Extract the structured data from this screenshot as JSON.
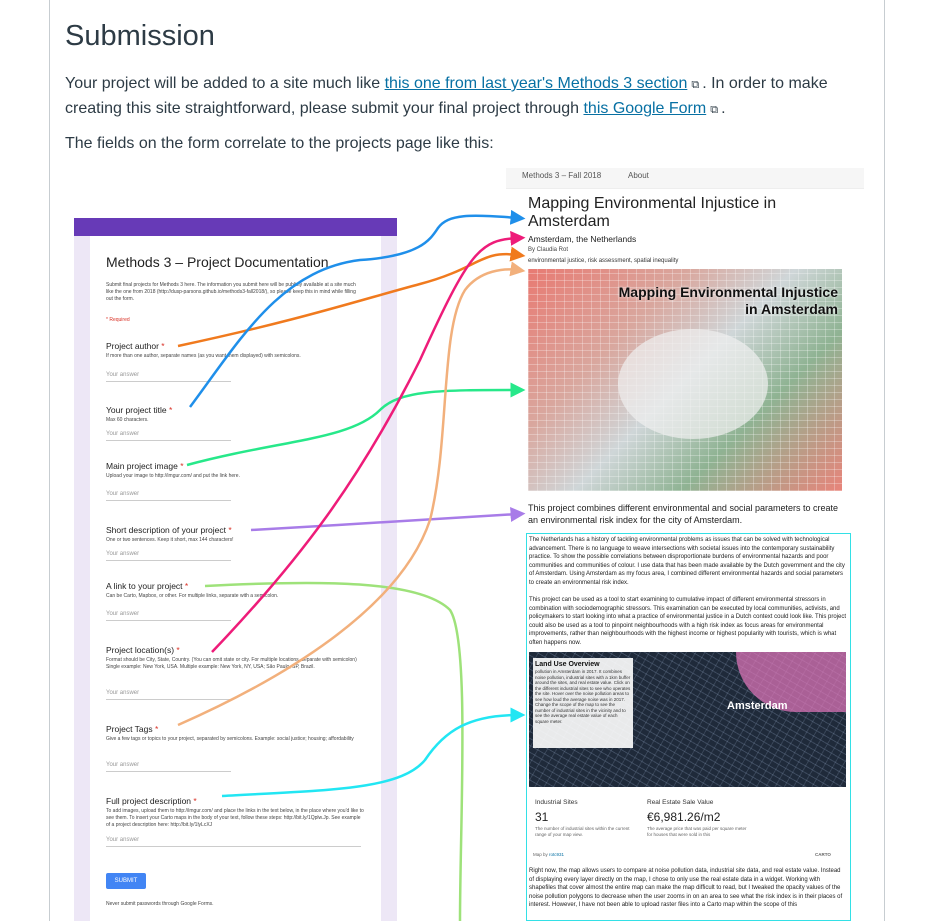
{
  "page": {
    "heading": "Submission",
    "intro_start": "Your project will be added to a site much like ",
    "link1": "this one from last year's Methods 3 section",
    "intro_mid": ". In order to make creating this site straightforward, please submit your final project through ",
    "link2": "this Google Form",
    "intro_end": ".",
    "correlate": "The fields on the form correlate to the projects page like this:",
    "external_icon": "external-link-icon"
  },
  "form": {
    "title": "Methods 3 – Project Documentation",
    "intro": "Submit final projects for Methods 3 here. The information you submit here will be publicly available at a site much like the one from 2018 (http://dusp-parsons.github.io/methods3-fall2018/), so please keep this in mind while filling out the form.",
    "required_note": "* Required",
    "answer_placeholder": "Your answer",
    "questions": [
      {
        "label": "Project author",
        "help": "If more than one author, separate names (as you want them displayed) with semicolons."
      },
      {
        "label": "Your project title",
        "help": "Max 60 characters."
      },
      {
        "label": "Main project image",
        "help": "Upload your image to http://imgur.com/ and put the link here."
      },
      {
        "label": "Short description of your project",
        "help": "One or two sentences. Keep it short, max 144 characters!"
      },
      {
        "label": "A link to your project",
        "help": "Can be Carto, Mapbox, or other. For multiple links, separate with a semicolon."
      },
      {
        "label": "Project location(s)",
        "help": "Format should be City, State, Country. (You can omit state or city. For multiple locations, separate with semicolon) Single example: New York, USA. Multiple example: New York, NY, USA; São Paulo, SP, Brazil."
      },
      {
        "label": "Project Tags",
        "help": "Give a few tags or topics to your project, separated by semicolons. Example: social justice; housing; affordability"
      },
      {
        "label": "Full project description",
        "help": "To add images, upload them to http://imgur.com/ and place the links in the text below, in the place where you'd like to see them. To insert your Carto maps in the body of your text, follow these steps: http://bit.ly/1Qplw.Jp. See example of a project description here: http://bit.ly/1lyLcXJ"
      }
    ],
    "submit": "SUBMIT",
    "footer": "Never submit passwords through Google Forms."
  },
  "project_page": {
    "nav_site": "Methods 3 – Fall 2018",
    "nav_about": "About",
    "title": "Mapping Environmental Injustice in Amsterdam",
    "location": "Amsterdam, the Netherlands",
    "author": "By Claudia Rot",
    "tags": "environmental justice, risk assessment, spatial inequality",
    "image_title_line1": "Mapping Environmental Injustice",
    "image_title_line2": "in Amsterdam",
    "short_description": "This project combines different environmental and social parameters to create an environmental risk index for the city of Amsterdam.",
    "body_p1": "The Netherlands has a history of tackling environmental problems as issues that can be solved with technological advancement. There is no language to weave intersections with societal issues into the contemporary sustainability practice. To show the possible correlations between disproportionate burdens of environmental hazards and poor communities and communities of colour. I use data that has been made available by the Dutch government and the city of Amsterdam. Using Amsterdam as my focus area, I combined different environmental hazards and social parameters to create an environmental risk index.",
    "body_p2": "This project can be used as a tool to start examining to cumulative impact of different environmental stressors in combination with sociodemographic stressors. This examination can be executed by local communities, activists, and policymakers to start looking into what a practice of environmental justice in a Dutch context could look like. This project could also be used as a tool to pinpoint neighbourhoods with a high risk index as focus areas for environmental improvements, rather than neighbourhoods with the highest income or highest popularity with tourists, which is what often happens now.",
    "embed_panel_title": "Land Use Overview",
    "embed_panel_text": "pollution in Amsterdam in 2017. It combines noise pollution, industrial sites with a 1km buffer around the sites, and real estate value. Click on the different industrial sites to see who operates the site. Hover over the noise pollution areas to see how loud the average noise was in 2017. Change the scope of the map to see the number of industrial sites in the vicinity and to see the average real estate value of each square meter.",
    "embed_city_label": "Amsterdam",
    "widget1_title": "Industrial Sites",
    "widget1_value": "31",
    "widget1_desc": "The number of industrial sites within the current range of your map view.",
    "widget2_title": "Real Estate Sale Value",
    "widget2_value": "€6,981.26/m2",
    "widget2_desc": "The average price that was paid per square meter for houses that were sold in this",
    "map_by": "Map by",
    "map_author": "rotc931",
    "carto_logo": "CARTO",
    "body_p3": "Right now, the map allows users to compare at noise pollution data, industrial site data, and real estate value. Instead of displaying every layer directly on the map, I chose to only use the real estate data in a widget. Working with shapefiles that cover almost the entire map can make the map difficult to read, but I tweaked the opacity values of the noise pollution polygons to decrease when the user zooms in on an area to see what the risk index is in their places of interest. However, I have not been able to upload raster files into a Carto map within the scope of this"
  },
  "arrow_colors": {
    "author": "#f07a1e",
    "title": "#1f8fea",
    "image": "#27e88a",
    "short": "#a87ce8",
    "link": "#9ee27a",
    "location": "#ee1c79",
    "tags": "#f2b07c",
    "full": "#22e6f3"
  }
}
